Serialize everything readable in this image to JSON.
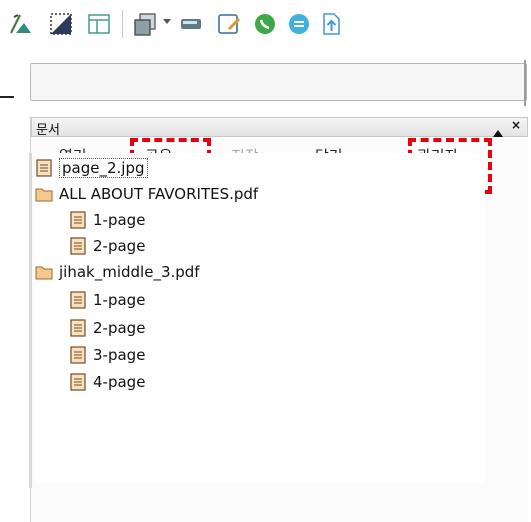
{
  "toolbar": {
    "buttons": [
      {
        "name": "pen-chart-icon"
      },
      {
        "name": "crop-icon"
      },
      {
        "name": "layout-icon"
      },
      {
        "name": "pages-icon"
      },
      {
        "name": "dropdown-arrow-icon"
      },
      {
        "name": "scanner-icon"
      },
      {
        "name": "note-edit-icon"
      },
      {
        "name": "phone-call-icon"
      },
      {
        "name": "chat-icon"
      },
      {
        "name": "upload-icon"
      }
    ]
  },
  "panel": {
    "title": "문서",
    "close": "×",
    "menu": {
      "open": "열기",
      "share": "공유",
      "save": "저장",
      "close": "닫기",
      "admin": "관리자"
    }
  },
  "tree": {
    "items": [
      {
        "label": "page_2.jpg",
        "type": "file",
        "level": 0,
        "selected": true
      },
      {
        "label": "ALL ABOUT FAVORITES.pdf",
        "type": "folder",
        "level": 0
      },
      {
        "label": "1-page",
        "type": "file",
        "level": 1
      },
      {
        "label": "2-page",
        "type": "file",
        "level": 1
      },
      {
        "label": "jihak_middle_3.pdf",
        "type": "folder",
        "level": 0
      },
      {
        "label": "1-page",
        "type": "file",
        "level": 1
      },
      {
        "label": "2-page",
        "type": "file",
        "level": 1
      },
      {
        "label": "3-page",
        "type": "file",
        "level": 1
      },
      {
        "label": "4-page",
        "type": "file",
        "level": 1
      }
    ]
  },
  "colors": {
    "highlight": "#e8000e",
    "file_icon": "#d49a55",
    "folder_icon": "#e8b779"
  }
}
